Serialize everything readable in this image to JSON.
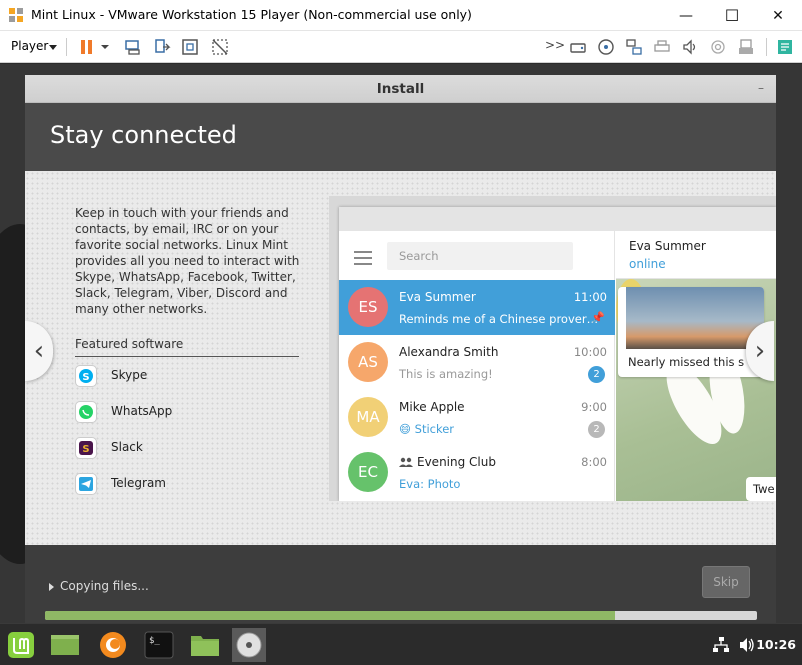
{
  "window": {
    "title": "Mint Linux - VMware Workstation 15 Player (Non-commercial use only)",
    "minimize": "—",
    "maximize": "☐",
    "close": "✕"
  },
  "toolbar": {
    "player_label": "Player",
    "overflow": ">>"
  },
  "installer": {
    "window_title": "Install",
    "minimize": "–",
    "heading": "Stay connected",
    "description": "Keep in touch with your friends and contacts, by email, IRC or on your favorite social networks. Linux Mint provides all you need to interact with Skype, WhatsApp, Facebook, Twitter, Slack, Telegram, Viber, Discord and many other networks.",
    "featured_label": "Featured software",
    "software": [
      {
        "name": "Skype",
        "icon": "skype-icon",
        "color": "#00aff0"
      },
      {
        "name": "WhatsApp",
        "icon": "whatsapp-icon",
        "color": "#25d366"
      },
      {
        "name": "Slack",
        "icon": "slack-icon",
        "color": "#4a154b"
      },
      {
        "name": "Telegram",
        "icon": "telegram-icon",
        "color": "#2ca5e0"
      }
    ],
    "prev_arrow": "‹",
    "next_arrow": "›",
    "status": "Copying files...",
    "skip_label": "Skip",
    "progress": 0.8
  },
  "telegram": {
    "search_placeholder": "Search",
    "chats": [
      {
        "initials": "ES",
        "name": "Eva Summer",
        "time": "11:00",
        "message": "Reminds me of a Chinese prover…",
        "avatar_color": "#e57373",
        "active": true,
        "pinned": true
      },
      {
        "initials": "AS",
        "name": "Alexandra Smith",
        "time": "10:00",
        "message": "This is amazing!",
        "avatar_color": "#f6a76b",
        "badge": "2",
        "badge_color": "#419fd9"
      },
      {
        "initials": "MA",
        "name": "Mike Apple",
        "time": "9:00",
        "message": "😄 Sticker",
        "avatar_color": "#f1d076",
        "badge": "2",
        "badge_color": "#b8b8b8"
      },
      {
        "initials": "EC",
        "name": "Evening Club",
        "time": "8:00",
        "message": "Eva: Photo",
        "avatar_color": "#66c26b",
        "group": true
      }
    ],
    "contact_name": "Eva Summer",
    "contact_status": "online",
    "photo_caption": "Nearly missed this s",
    "second_bubble": "Twe"
  },
  "panel": {
    "clock": "10:26",
    "terminal_prompt": "$_"
  }
}
